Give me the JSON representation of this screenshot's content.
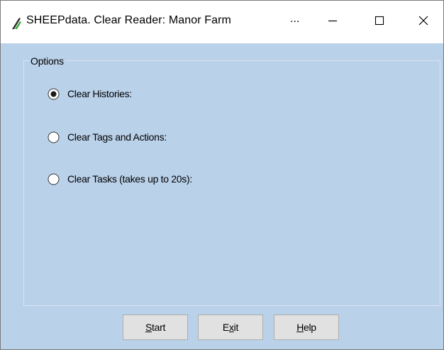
{
  "window": {
    "title": "SHEEPdata. Clear Reader: Manor Farm",
    "title_ellipsis": "...",
    "controls": {
      "minimize_icon": "minimize-icon",
      "maximize_icon": "maximize-icon",
      "close_icon": "close-icon"
    },
    "app_icon": "sheepdata-logo-icon"
  },
  "options_group": {
    "label": "Options",
    "radios": [
      {
        "label": "Clear Histories:",
        "selected": true
      },
      {
        "label": "Clear Tags and Actions:",
        "selected": false
      },
      {
        "label": "Clear Tasks (takes up to 20s):",
        "selected": false
      }
    ]
  },
  "buttons": {
    "start": {
      "mnemonic": "S",
      "rest": "tart"
    },
    "exit": {
      "pre": "E",
      "mnemonic": "x",
      "rest": "it"
    },
    "help": {
      "mnemonic": "H",
      "rest": "elp"
    }
  },
  "colors": {
    "client_background": "#bad1ea",
    "titlebar_background": "#ffffff",
    "button_face": "#e1e1e1",
    "logo_green": "#3aaa35",
    "logo_dark": "#2b2b2b"
  }
}
